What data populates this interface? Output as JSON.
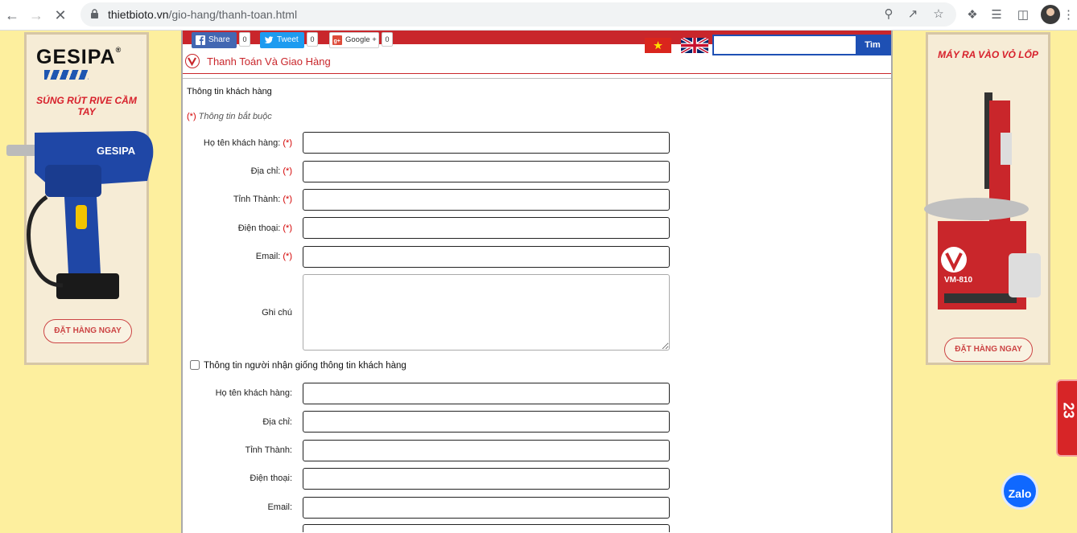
{
  "browser": {
    "url_domain": "thietbioto.vn",
    "url_path": "/gio-hang/thanh-toan.html"
  },
  "left_banner": {
    "brand": "GESIPA",
    "title": "SÚNG RÚT RIVE CẦM TAY",
    "tool_label": "GESIPA",
    "order_button": "ĐẶT HÀNG NGAY"
  },
  "right_banner": {
    "title": "MÁY RA VÀO VỎ LỐP",
    "model": "VM-810",
    "order_button": "ĐẶT HÀNG NGAY"
  },
  "social": {
    "facebook_label": "Share",
    "facebook_count": "0",
    "twitter_label": "Tweet",
    "twitter_count": "0",
    "google_label": "Google +",
    "google_count": "0"
  },
  "search": {
    "placeholder": "",
    "button": "Tìm"
  },
  "breadcrumb": "Thanh Toán Và Giao Hàng",
  "customer_section": {
    "title": "Thông tin khách hàng",
    "required_marker": "(*)",
    "required_note": "Thông tin bắt buộc",
    "fields": [
      {
        "label": "Họ tên khách hàng:",
        "required": "(*)",
        "value": ""
      },
      {
        "label": "Địa chỉ:",
        "required": "(*)",
        "value": ""
      },
      {
        "label": "Tỉnh Thành:",
        "required": "(*)",
        "value": ""
      },
      {
        "label": "Điện thoại:",
        "required": "(*)",
        "value": ""
      },
      {
        "label": "Email:",
        "required": "(*)",
        "value": ""
      }
    ],
    "note_label": "Ghi chú"
  },
  "recipient_section": {
    "checkbox_label": "Thông tin người nhận giống thông tin khách hàng",
    "fields": [
      {
        "label": "Họ tên khách hàng:",
        "value": ""
      },
      {
        "label": "Địa chỉ:",
        "value": ""
      },
      {
        "label": "Tỉnh Thành:",
        "value": ""
      },
      {
        "label": "Điện thoại:",
        "value": ""
      },
      {
        "label": "Email:",
        "value": ""
      }
    ]
  },
  "widgets": {
    "side_tab_number": "23",
    "zalo_label": "Zalo"
  },
  "colors": {
    "brand_red": "#c9262b",
    "search_blue": "#1e50b4",
    "page_background": "#fdef9e",
    "zalo_blue": "#0f68ff"
  }
}
